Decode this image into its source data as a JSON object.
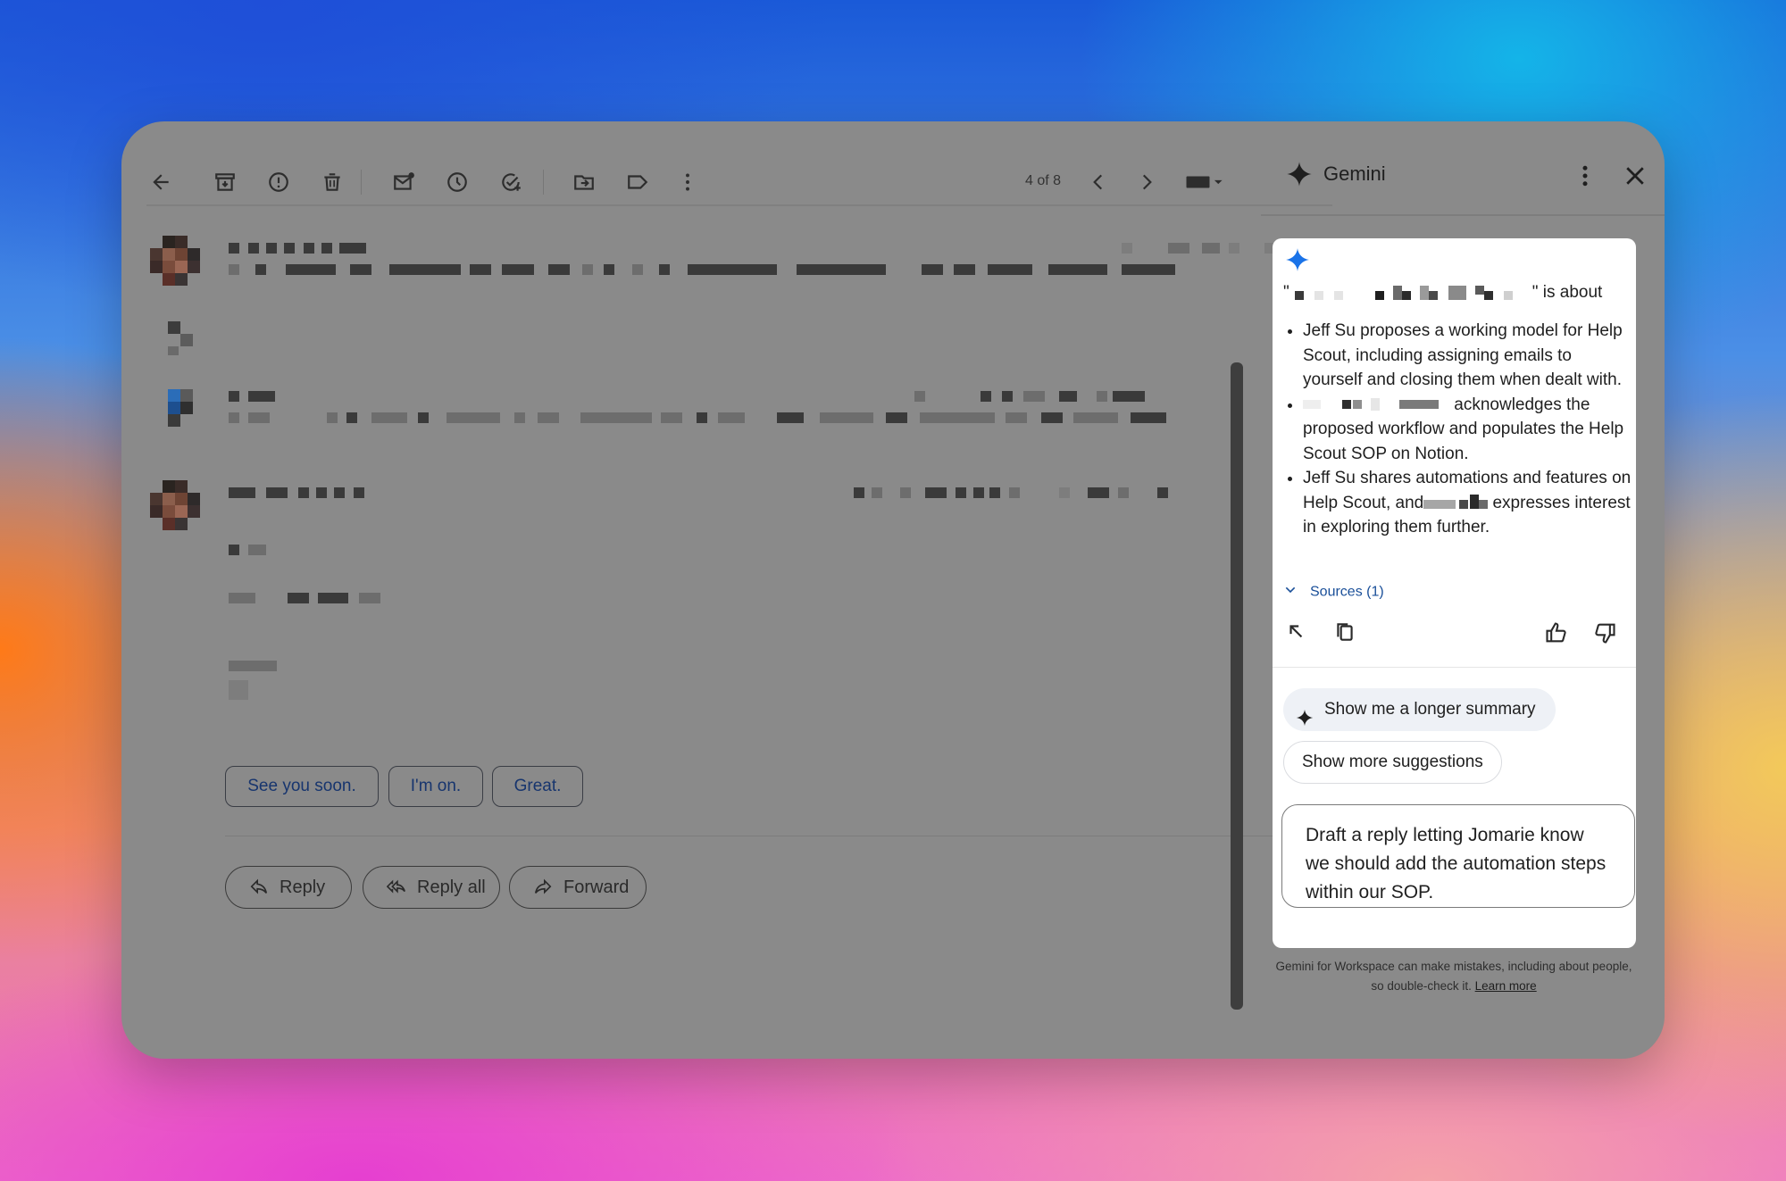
{
  "toolbar": {
    "icons": [
      "back-arrow-icon",
      "archive-icon",
      "report-spam-icon",
      "delete-icon",
      "mark-unread-icon",
      "snooze-icon",
      "add-task-icon",
      "move-to-icon",
      "label-icon",
      "more-vert-icon"
    ],
    "pager": "4 of 8"
  },
  "smart_replies": [
    "See you soon.",
    "I'm on.",
    "Great."
  ],
  "actions": {
    "reply": "Reply",
    "reply_all": "Reply all",
    "forward": "Forward"
  },
  "gemini": {
    "title": "Gemini",
    "about_open_quote": "\"",
    "about_suffix": "\" is about",
    "bullets": {
      "b1": "Jeff Su proposes a working model for Help Scout, including assigning emails to yourself and closing them when dealt with.",
      "b2": "acknowledges the proposed workflow and populates the Help Scout SOP on Notion.",
      "b3_a": "Jeff Su shares automations and features on Help Scout, and",
      "b3_b": "expresses interest in exploring them further."
    },
    "sources": "Sources (1)",
    "suggestion_primary": "Show me a longer summary",
    "suggestion_more": "Show more suggestions",
    "prompt": "Draft a reply letting Jomarie know we should add the automation steps within our SOP.",
    "disclaimer": "Gemini for Workspace can make mistakes, including about people, so double-check it.",
    "learn_more": "Learn more"
  },
  "colors": {
    "gemini_blue": "#1a73e8",
    "chip_text": "#17356e",
    "link_blue": "#1a4f99"
  }
}
